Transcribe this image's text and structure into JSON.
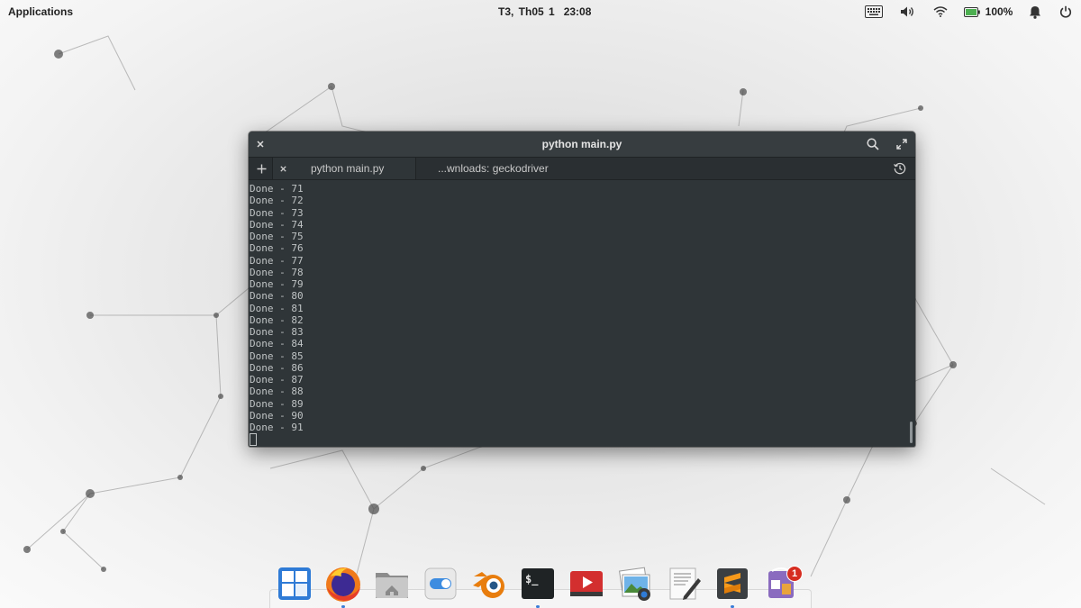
{
  "panel": {
    "applications_label": "Applications",
    "date": "T3, Th05  1",
    "time": "23:08",
    "battery": "100%"
  },
  "window": {
    "title": "python main.py",
    "tabs": [
      {
        "label": "python main.py",
        "active": true
      },
      {
        "label": "...wnloads: geckodriver",
        "active": false
      }
    ],
    "output_lines": [
      "Done - 71",
      "Done - 72",
      "Done - 73",
      "Done - 74",
      "Done - 75",
      "Done - 76",
      "Done - 77",
      "Done - 78",
      "Done - 79",
      "Done - 80",
      "Done - 81",
      "Done - 82",
      "Done - 83",
      "Done - 84",
      "Done - 85",
      "Done - 86",
      "Done - 87",
      "Done - 88",
      "Done - 89",
      "Done - 90",
      "Done - 91"
    ]
  },
  "dock": {
    "items": [
      {
        "icon": "multitasking-view-icon"
      },
      {
        "icon": "firefox-icon",
        "running": true
      },
      {
        "icon": "files-icon"
      },
      {
        "icon": "system-settings-icon"
      },
      {
        "icon": "blender-icon"
      },
      {
        "icon": "terminal-icon",
        "running": true
      },
      {
        "icon": "videos-icon"
      },
      {
        "icon": "photos-icon"
      },
      {
        "icon": "text-editor-icon"
      },
      {
        "icon": "sublime-text-icon",
        "running": true
      },
      {
        "icon": "appcenter-icon",
        "badge": "1"
      }
    ]
  },
  "colors": {
    "terminal_bg": "#2f3538",
    "terminal_fg": "#bfc3c4",
    "titlebar_bg": "#373d40",
    "accent": "#3b7dd8"
  }
}
